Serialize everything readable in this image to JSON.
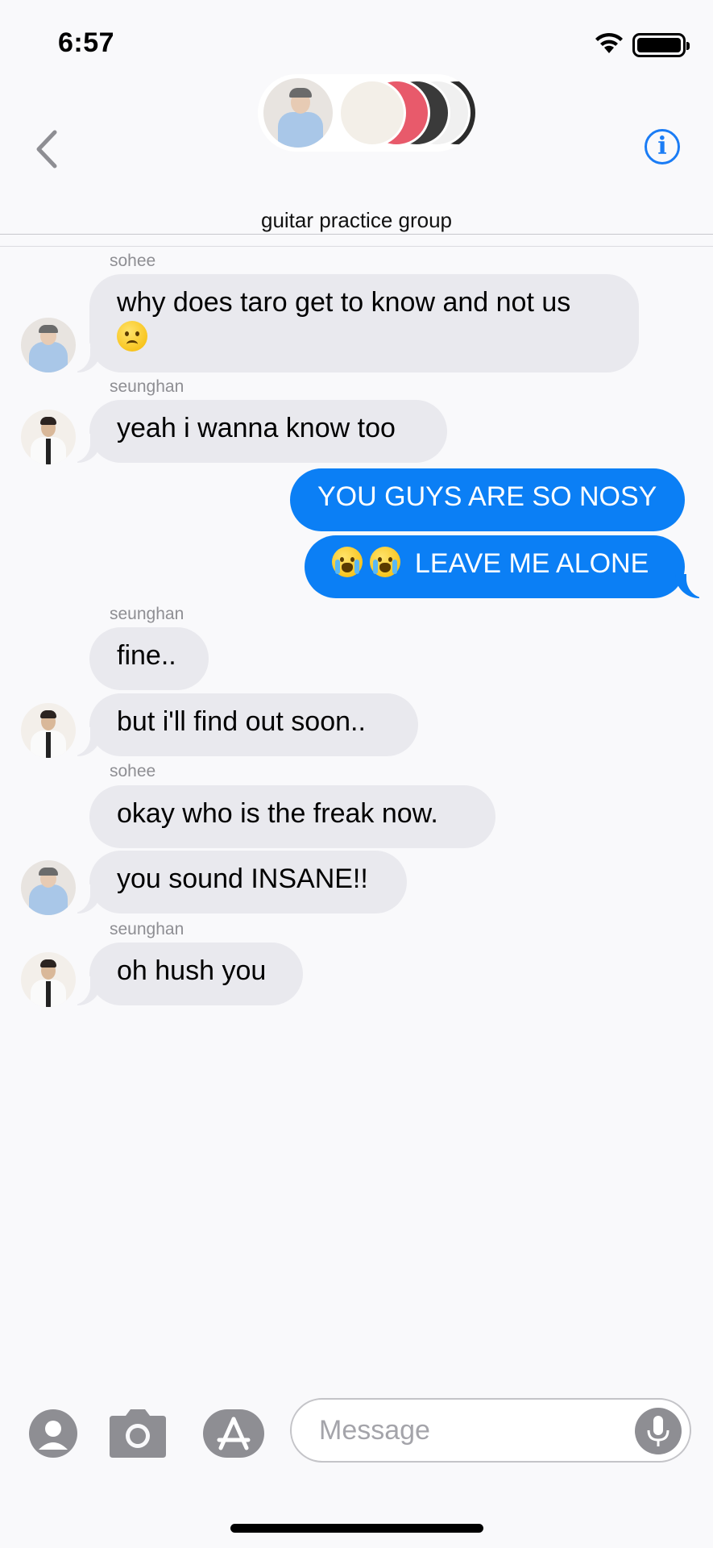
{
  "status_bar": {
    "time": "6:57"
  },
  "header": {
    "group_name": "guitar practice group",
    "back_icon": "chevron-left-icon",
    "info_icon": "info-icon"
  },
  "colors": {
    "accent": "#0b7ff5",
    "incoming_bubble": "#e9e9ee",
    "background": "#f9f9fb"
  },
  "messages": [
    {
      "sender": "sohee",
      "text": "why does taro get to know and not us",
      "emoji": "slightly-frowning-face"
    },
    {
      "sender": "seunghan",
      "text": "yeah i wanna know too"
    },
    {
      "outgoing": true,
      "text": "YOU GUYS ARE SO NOSY"
    },
    {
      "outgoing": true,
      "text": "LEAVE ME ALONE",
      "emoji": "loudly-crying-face x2"
    },
    {
      "sender": "seunghan",
      "text": "fine.."
    },
    {
      "text": "but i'll find out soon.."
    },
    {
      "sender": "sohee",
      "text": "okay who is the freak now."
    },
    {
      "text": "you sound INSANE!!"
    },
    {
      "sender": "seunghan",
      "text": "oh hush you"
    }
  ],
  "input_bar": {
    "placeholder": "Message",
    "apps_icon": "apps-icon",
    "camera_icon": "camera-icon",
    "app_store_icon": "app-store-icon",
    "mic_icon": "microphone-icon"
  }
}
